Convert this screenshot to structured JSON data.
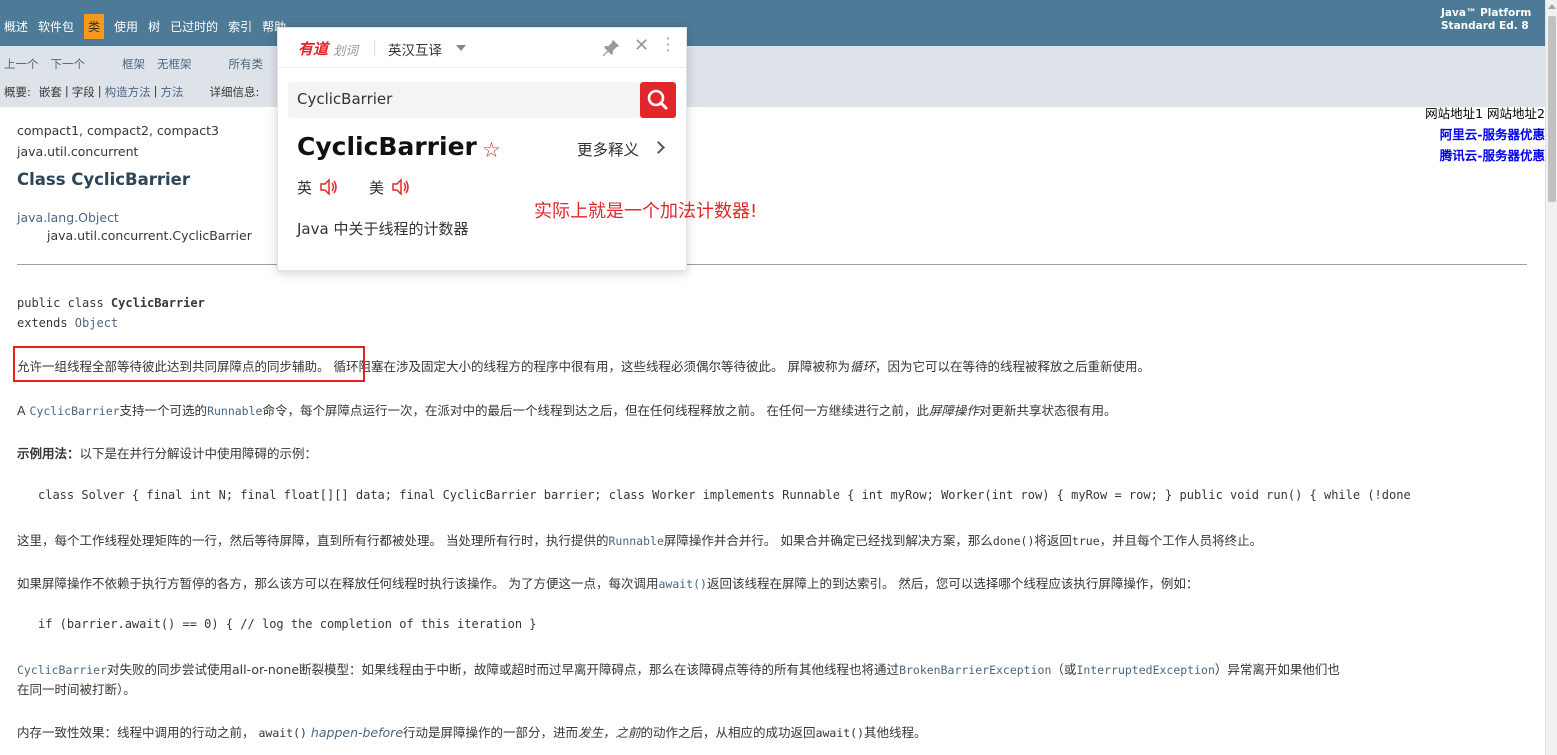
{
  "topnav": {
    "items": [
      "概述",
      "软件包",
      "类",
      "使用",
      "树",
      "已过时的",
      "索引",
      "帮助"
    ],
    "active_index": 2,
    "platform_line1": "Java™ Platform",
    "platform_line2": "Standard Ed. 8"
  },
  "subnav": {
    "prev": "上一个",
    "next": "下一个",
    "frames": "框架",
    "noframes": "无框架",
    "allclasses": "所有类",
    "summary_label": "概要:",
    "summary_nested": "嵌套",
    "summary_field": "字段",
    "summary_constr": "构造方法",
    "summary_method": "方法",
    "detail_label": "详细信息:",
    "sep": "|"
  },
  "ads": {
    "line1": "网站地址1 网站地址2",
    "aliyun": "阿里云-服务器优惠",
    "tencent": "腾讯云-服务器优惠"
  },
  "header": {
    "profiles": "compact1, compact2, compact3",
    "package": "java.util.concurrent",
    "class_title": "Class CyclicBarrier",
    "inherit_parent": "java.lang.Object",
    "inherit_child": "java.util.concurrent.CyclicBarrier"
  },
  "declaration": {
    "line1_prefix": "public class ",
    "line1_name": "CyclicBarrier",
    "line2_prefix": "extends ",
    "line2_link": "Object"
  },
  "body": {
    "p1_highlight": "允许一组线程全部等待彼此达到共同屏障点的同步辅助。",
    "p1_rest": " 循环阻塞在涉及固定大小的线程方的程序中很有用，这些线程必须偶尔等待彼此。 屏障被称为",
    "p1_italic": "循环",
    "p1_tail": "，因为它可以在等待的线程被释放之后重新使用。",
    "p2_a": "A ",
    "p2_code1": "CyclicBarrier",
    "p2_b": "支持一个可选的",
    "p2_code2": "Runnable",
    "p2_c": "命令，每个屏障点运行一次，在派对中的最后一个线程到达之后，但在任何线程释放之前。 在任何一方继续进行之前，此",
    "p2_italic": "屏障操作",
    "p2_d": "对更新共享状态很有用。",
    "p3_bold": "示例用法：",
    "p3_rest": "以下是在并行分解设计中使用障碍的示例：",
    "code1": "class Solver { final int N; final float[][] data; final CyclicBarrier barrier; class Worker implements Runnable { int myRow; Worker(int row) { myRow = row; } public void run() { while (!done",
    "p4_a": "这里，每个工作线程处理矩阵的一行，然后等待屏障，直到所有行都被处理。 当处理所有行时，执行提供的",
    "p4_code1": "Runnable",
    "p4_b": "屏障操作并合并行。 如果合并确定已经找到解决方案，那么",
    "p4_code2": "done()",
    "p4_c": "将返回",
    "p4_code3": "true",
    "p4_d": "，并且每个工作人员将终止。",
    "p5_a": "如果屏障操作不依赖于执行方暂停的各方，那么该方可以在释放任何线程时执行该操作。 为了方便这一点，每次调用",
    "p5_code": "await()",
    "p5_b": "返回该线程在屏障上的到达索引。 然后，您可以选择哪个线程应该执行屏障操作，例如：",
    "code2": "if (barrier.await() == 0) { // log the completion of this iteration }",
    "p6_code1": "CyclicBarrier",
    "p6_a": "对失败的同步尝试使用all-or-none断裂模型：如果线程由于中断，故障或超时而过早离开障碍点，那么在该障碍点等待的所有其他线程也将通过",
    "p6_code2": "BrokenBarrierException",
    "p6_b": "（或",
    "p6_code3": "InterruptedException",
    "p6_c": "）异常离开如果他们也",
    "p6_line2": "在同一时间被打断）。",
    "p7_a": "内存一致性效果：线程中调用的行动之前， ",
    "p7_code1": "await()",
    "p7_italic1": " happen-before",
    "p7_b": "行动是屏障操作的一部分，进而",
    "p7_italic2": "发生，之前",
    "p7_c": "的动作之后，从相应的成功返回",
    "p7_code2": "await()",
    "p7_d": "其他线程。"
  },
  "popup": {
    "logo": "有道",
    "logo_sub": "划词",
    "mode": "英汉互译",
    "search_value": "CyclicBarrier",
    "word": "CyclicBarrier",
    "more_defs": "更多释义",
    "pron_uk": "英",
    "pron_us": "美",
    "definition": "Java 中关于线程的计数器",
    "accent": "#e3262a"
  },
  "annotation": "实际上就是一个加法计数器!"
}
